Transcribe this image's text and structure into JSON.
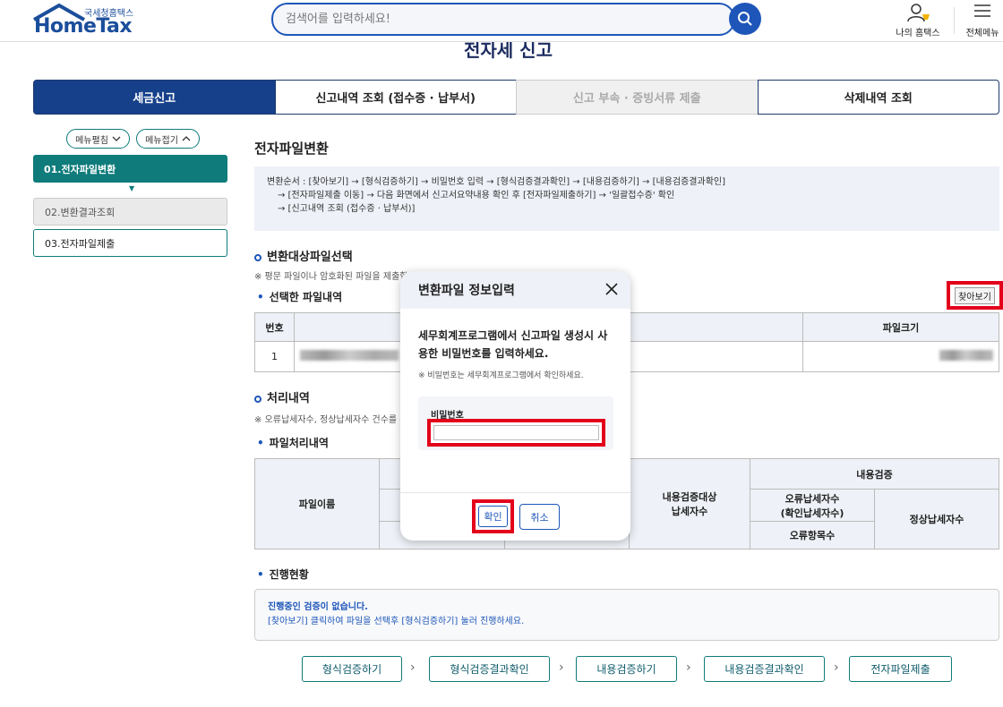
{
  "header": {
    "logo_sub": "국세청홈택스",
    "logo_main": "HomeTax",
    "search_placeholder": "검색어를 입력하세요!",
    "my_home": "나의 홈택스",
    "all_menu": "전체메뉴"
  },
  "page_title_behind": "전자세 신고",
  "tabs": [
    {
      "label": "세금신고"
    },
    {
      "label": "신고내역 조회 (접수증 · 납부서)"
    },
    {
      "label": "신고 부속 · 증빙서류 제출"
    },
    {
      "label": "삭제내역 조회"
    }
  ],
  "sidebar": {
    "expand": "메뉴펼침",
    "collapse": "메뉴접기",
    "items": [
      {
        "label": "01.전자파일변환"
      },
      {
        "label": "02.변환결과조회"
      },
      {
        "label": "03.전자파일제출"
      }
    ]
  },
  "main": {
    "title": "전자파일변환",
    "info_lines": [
      "변환순서 : [찾아보기] → [형식검증하기] → 비밀번호 입력 → [형식검증결과확인] → [내용검증하기] → [내용검증결과확인]",
      "→ [전자파일제출 이동] → 다음 화면에서 신고서요약내용 확인 후 [전자파일제출하기] → '일괄접수증' 확인",
      "→ [신고내역 조회 (접수증 · 납부서)]"
    ],
    "section1_title": "변환대상파일선택",
    "section1_note": "※ 평문 파일이나 암호화된 파일을 제출할 수 있습니다.",
    "selected_files_title": "선택한 파일내역",
    "find_button": "찾아보기",
    "file_table": {
      "headers": [
        "번호",
        "",
        "파일크기"
      ],
      "rows": [
        [
          "1",
          "",
          ""
        ]
      ]
    },
    "section2_title": "처리내역",
    "section2_note": "※ 오류납세자수, 정상납세자수 건수를 확인하세요.",
    "processing_title": "파일처리내역",
    "proc_table": {
      "file_name": "파일이름",
      "content_check": "내용검증",
      "content_target": "내용검증대상\n납세자수",
      "error_taxpayers": "오류납세자수\n(확인납세자수)",
      "normal_taxpayers": "정상납세자수",
      "error_items": "오류항목수"
    },
    "progress_title": "진행현황",
    "progress_strong": "진행중인 검증이 없습니다.",
    "progress_sub": "[찾아보기] 클릭하여 파일을 선택후 [형식검증하기] 눌러 진행하세요."
  },
  "steps": [
    {
      "label": "형식검증하기"
    },
    {
      "label": "형식검증결과확인"
    },
    {
      "label": "내용검증하기"
    },
    {
      "label": "내용검증결과확인"
    },
    {
      "label": "전자파일제출"
    }
  ],
  "modal": {
    "title": "변환파일 정보입력",
    "message": "세무회계프로그램에서 신고파일 생성시 사용한 비밀번호를 입력하세요.",
    "note": "※ 비밀번호는 세무회계프로그램에서 확인하세요.",
    "pw_label": "비밀번호",
    "pw_value": "",
    "ok": "확인",
    "cancel": "취소"
  },
  "colors": {
    "primary": "#17408b",
    "teal": "#0f7b7b",
    "highlight": "#e3001b"
  }
}
